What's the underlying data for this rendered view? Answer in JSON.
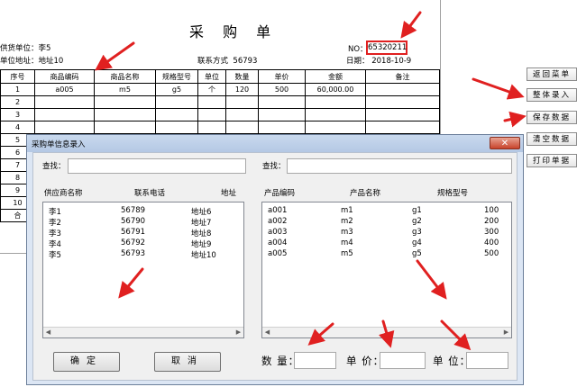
{
  "sheet": {
    "title": "采 购 单",
    "supplier_label": "供货单位：",
    "supplier_value": "李5",
    "address_label": "单位地址：",
    "address_value": "地址10",
    "contact_label": "联系方式",
    "contact_value": "56793",
    "no_label": "NO：",
    "no_value": "65320211",
    "date_label": "日期：",
    "date_value": "2018-10-9",
    "columns": [
      "序号",
      "商品编码",
      "商品名称",
      "规格型号",
      "单位",
      "数量",
      "单价",
      "金额",
      "备注"
    ],
    "rows": [
      [
        "1",
        "a005",
        "m5",
        "g5",
        "个",
        "120",
        "500",
        "60,000.00",
        ""
      ],
      [
        "2",
        "",
        "",
        "",
        "",
        "",
        "",
        "",
        ""
      ],
      [
        "3",
        "",
        "",
        "",
        "",
        "",
        "",
        "",
        ""
      ],
      [
        "4",
        "",
        "",
        "",
        "",
        "",
        "",
        "",
        ""
      ],
      [
        "5",
        "",
        "",
        "",
        "",
        "",
        "",
        "",
        ""
      ],
      [
        "6",
        "",
        "",
        "",
        "",
        "",
        "",
        "",
        ""
      ],
      [
        "7",
        "",
        "",
        "",
        "",
        "",
        "",
        "",
        ""
      ],
      [
        "8",
        "",
        "",
        "",
        "",
        "",
        "",
        "",
        ""
      ],
      [
        "9",
        "",
        "",
        "",
        "",
        "",
        "",
        "",
        ""
      ],
      [
        "10",
        "",
        "",
        "",
        "",
        "",
        "",
        "",
        ""
      ],
      [
        "合",
        "",
        "",
        "",
        "",
        "",
        "",
        "",
        ""
      ]
    ]
  },
  "side_buttons": [
    "返回菜单",
    "整体录入",
    "保存数据",
    "清空数据",
    "打印单据"
  ],
  "dialog": {
    "title": "采购单信息录入",
    "close_glyph": "✕",
    "left": {
      "search_label": "查找：",
      "search_value": "",
      "headers": [
        "供应商名称",
        "联系电话",
        "地址"
      ],
      "rows": [
        [
          "李1",
          "56789",
          "地址6"
        ],
        [
          "李2",
          "56790",
          "地址7"
        ],
        [
          "李3",
          "56791",
          "地址8"
        ],
        [
          "李4",
          "56792",
          "地址9"
        ],
        [
          "李5",
          "56793",
          "地址10"
        ]
      ]
    },
    "right": {
      "search_label": "查找：",
      "search_value": "",
      "headers": [
        "产品编码",
        "产品名称",
        "规格型号"
      ],
      "rows": [
        [
          "a001",
          "m1",
          "g1",
          "100"
        ],
        [
          "a002",
          "m2",
          "g2",
          "200"
        ],
        [
          "a003",
          "m3",
          "g3",
          "300"
        ],
        [
          "a004",
          "m4",
          "g4",
          "400"
        ],
        [
          "a005",
          "m5",
          "g5",
          "500"
        ]
      ]
    },
    "confirm_label": "确定",
    "cancel_label": "取消",
    "quantity_label": "数 量：",
    "unit_price_label": "单 价：",
    "unit_label": "单 位：",
    "quantity_value": "",
    "unit_price_value": "",
    "unit_value": ""
  },
  "colors": {
    "annotation_red": "#e02020",
    "dialog_frame": "#dce6f4",
    "close_button": "#c8432b"
  }
}
